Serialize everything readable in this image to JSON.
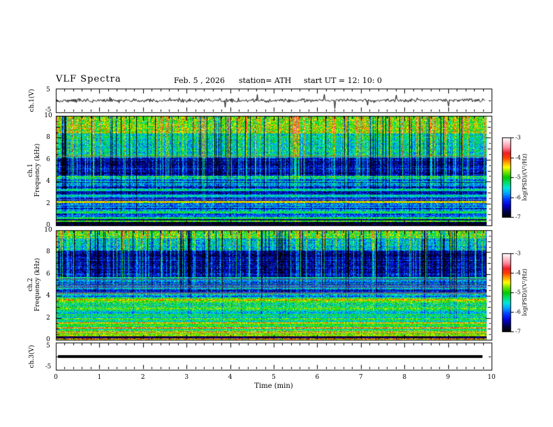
{
  "header": {
    "title": "VLF Spectra",
    "date": "Feb. 5  , 2026",
    "station": "station= ATH",
    "start_ut": "start UT =  12: 10: 0"
  },
  "axes": {
    "time_label": "Time (min)",
    "time_ticks": [
      "0",
      "1",
      "2",
      "3",
      "4",
      "5",
      "6",
      "7",
      "8",
      "9",
      "10"
    ],
    "freq_label": "Frequency (kHz)",
    "freq_ticks": [
      "10",
      "8",
      "6",
      "4",
      "2",
      "0"
    ],
    "volt_ticks": [
      "5",
      "-5"
    ],
    "colorbar_label": "log(PSD)/(V²/Hz)",
    "colorbar_ticks": [
      "-3",
      "-4",
      "-5",
      "-6",
      "-7"
    ]
  },
  "panels": {
    "ch1_wave_label": "ch.1(V)",
    "ch1_spec_label": "ch.1",
    "ch2_spec_label": "ch.2",
    "ch3_wave_label": "ch.3(V)"
  },
  "colors": {
    "background": "#ffffff",
    "axis": "#000000",
    "waveform": "#000000",
    "colormap_stops": [
      [
        0.0,
        "#000000"
      ],
      [
        0.07,
        "#000046"
      ],
      [
        0.15,
        "#0000d2"
      ],
      [
        0.22,
        "#0032ff"
      ],
      [
        0.3,
        "#00a0ff"
      ],
      [
        0.37,
        "#00e6dc"
      ],
      [
        0.44,
        "#00dc64"
      ],
      [
        0.5,
        "#00c800"
      ],
      [
        0.57,
        "#78e600"
      ],
      [
        0.63,
        "#ffff00"
      ],
      [
        0.69,
        "#ffa000"
      ],
      [
        0.75,
        "#ff3c00"
      ],
      [
        0.81,
        "#f01e28"
      ],
      [
        0.88,
        "#ff8ca0"
      ],
      [
        0.95,
        "#ffd2da"
      ],
      [
        1.0,
        "#ffffff"
      ]
    ]
  },
  "chart_data": [
    {
      "type": "line",
      "name": "ch1_waveform",
      "ylabel": "ch.1(V)",
      "units": "V",
      "xlim_min": [
        0,
        10
      ],
      "ylim": [
        -5,
        5
      ],
      "yticks": [
        5,
        -5
      ],
      "signal": {
        "baseline_v": 0,
        "noise_amp_v": 1.0,
        "spike_down_v": 4.0,
        "spike_up_v": 3.0,
        "seed": 55
      }
    },
    {
      "type": "heatmap",
      "name": "ch1_spectrogram",
      "ylabel": "ch.1 Frequency (kHz)",
      "xlim_min": [
        0,
        10
      ],
      "ylim_khz": [
        0,
        10
      ],
      "clim_log_psd": [
        -7,
        -3
      ],
      "colorbar_label": "log(PSD)/(V²/Hz)",
      "bands": [
        [
          0.0,
          0.28,
          -6.9,
          0.5,
          0.15,
          0.25
        ],
        [
          0.28,
          0.42,
          -4.9,
          0.45,
          0.1,
          0.3
        ],
        [
          0.42,
          0.58,
          -6.7,
          0.5,
          0.1,
          0.25
        ],
        [
          0.58,
          0.75,
          -5.2,
          0.4,
          0.1,
          0.3
        ],
        [
          0.75,
          1.05,
          -6.0,
          0.5,
          0.2,
          0.4
        ],
        [
          1.05,
          1.25,
          -5.0,
          0.4,
          0.1,
          0.3
        ],
        [
          1.25,
          2.0,
          -5.9,
          0.5,
          0.25,
          0.45
        ],
        [
          2.0,
          2.25,
          -4.5,
          0.4,
          0.1,
          0.3
        ],
        [
          2.25,
          2.6,
          -6.15,
          0.45,
          0.2,
          0.45
        ],
        [
          2.6,
          2.78,
          -5.4,
          0.4,
          0.15,
          0.3
        ],
        [
          2.78,
          3.15,
          -6.3,
          0.45,
          0.25,
          0.45
        ],
        [
          3.15,
          3.35,
          -5.35,
          0.4,
          0.2,
          0.3
        ],
        [
          3.35,
          4.2,
          -6.0,
          0.5,
          0.5,
          0.5
        ],
        [
          4.2,
          4.55,
          -5.3,
          0.45,
          0.45,
          0.35
        ],
        [
          4.55,
          6.25,
          -6.45,
          0.45,
          1.0,
          0.35
        ],
        [
          6.25,
          8.5,
          -5.45,
          0.5,
          1.0,
          0.25
        ],
        [
          8.5,
          10.0,
          -4.8,
          0.55,
          1.0,
          0.2
        ]
      ],
      "interference_lines": [
        {
          "f_khz": 6.3,
          "color": "#787878",
          "alpha": 0.6,
          "w": 2
        },
        {
          "f_khz": 2.35,
          "color": "#888888",
          "alpha": 0.3,
          "w": 2
        }
      ],
      "texture": {
        "seed": 101,
        "dropout_p": 0.013,
        "dark_p": 0.08,
        "dark_amp": [
          0.9,
          2.4
        ],
        "bright_p": 0.15,
        "bright_amp": [
          0.5,
          1.3
        ],
        "base_jitter": 0.5
      }
    },
    {
      "type": "heatmap",
      "name": "ch2_spectrogram",
      "ylabel": "ch.2 Frequency (kHz)",
      "xlim_min": [
        0,
        10
      ],
      "ylim_khz": [
        0,
        10
      ],
      "clim_log_psd": [
        -7,
        -3
      ],
      "colorbar_label": "log(PSD)/(V²/Hz)",
      "bands": [
        [
          0.0,
          0.12,
          -4.2,
          0.6,
          0.0,
          0.4
        ],
        [
          0.12,
          0.28,
          -6.7,
          0.5,
          0.0,
          0.35
        ],
        [
          0.28,
          0.52,
          -4.6,
          0.4,
          0.0,
          0.3
        ],
        [
          0.52,
          0.62,
          -5.2,
          0.35,
          0.0,
          0.3
        ],
        [
          0.62,
          0.75,
          -4.35,
          0.35,
          0.0,
          0.3
        ],
        [
          0.75,
          1.0,
          -5.1,
          0.4,
          0.0,
          0.35
        ],
        [
          1.0,
          1.12,
          -4.4,
          0.35,
          0.0,
          0.3
        ],
        [
          1.12,
          1.42,
          -5.15,
          0.4,
          0.05,
          0.35
        ],
        [
          1.42,
          1.58,
          -4.3,
          0.4,
          0.05,
          0.3
        ],
        [
          1.58,
          2.2,
          -5.2,
          0.45,
          0.1,
          0.45
        ],
        [
          2.2,
          2.35,
          -4.95,
          0.4,
          0.1,
          0.3
        ],
        [
          2.35,
          3.45,
          -5.25,
          0.45,
          0.15,
          0.45
        ],
        [
          3.45,
          3.58,
          -5.05,
          0.4,
          0.1,
          0.3
        ],
        [
          3.58,
          3.75,
          -4.2,
          0.65,
          0.05,
          0.55
        ],
        [
          3.75,
          4.2,
          -5.6,
          0.5,
          0.2,
          0.55
        ],
        [
          4.2,
          4.35,
          -5.9,
          0.55,
          0.15,
          0.55
        ],
        [
          4.35,
          5.05,
          -6.05,
          0.5,
          0.3,
          0.6
        ],
        [
          5.05,
          5.65,
          -5.9,
          0.5,
          0.4,
          0.6
        ],
        [
          5.65,
          5.8,
          -5.3,
          0.4,
          0.4,
          0.35
        ],
        [
          5.8,
          8.25,
          -6.5,
          0.45,
          1.0,
          0.3
        ],
        [
          8.25,
          9.35,
          -5.55,
          0.5,
          1.0,
          0.25
        ],
        [
          9.35,
          10.0,
          -4.95,
          0.55,
          0.9,
          0.2
        ]
      ],
      "interference_lines": [
        {
          "f_khz": 5.55,
          "color": "#787878",
          "alpha": 0.5,
          "w": 2
        },
        {
          "f_khz": 5.0,
          "color": "#808080",
          "alpha": 0.45,
          "w": 2
        },
        {
          "f_khz": 4.8,
          "color": "#808080",
          "alpha": 0.45,
          "w": 2
        },
        {
          "f_khz": 4.28,
          "color": "#7a4a8a",
          "alpha": 0.7,
          "w": 2
        }
      ],
      "texture": {
        "seed": 202,
        "dropout_p": 0.012,
        "dark_p": 0.09,
        "dark_amp": [
          0.8,
          2.2
        ],
        "bright_p": 0.16,
        "bright_amp": [
          0.5,
          1.2
        ],
        "base_jitter": 0.5
      }
    },
    {
      "type": "line",
      "name": "ch3_waveform",
      "ylabel": "ch.3(V)",
      "units": "V",
      "xlim_min": [
        0,
        10
      ],
      "ylim": [
        -5,
        5
      ],
      "yticks": [
        5,
        -5
      ],
      "signal": {
        "constant_v": 0,
        "line_thickness_px": 4
      }
    }
  ]
}
